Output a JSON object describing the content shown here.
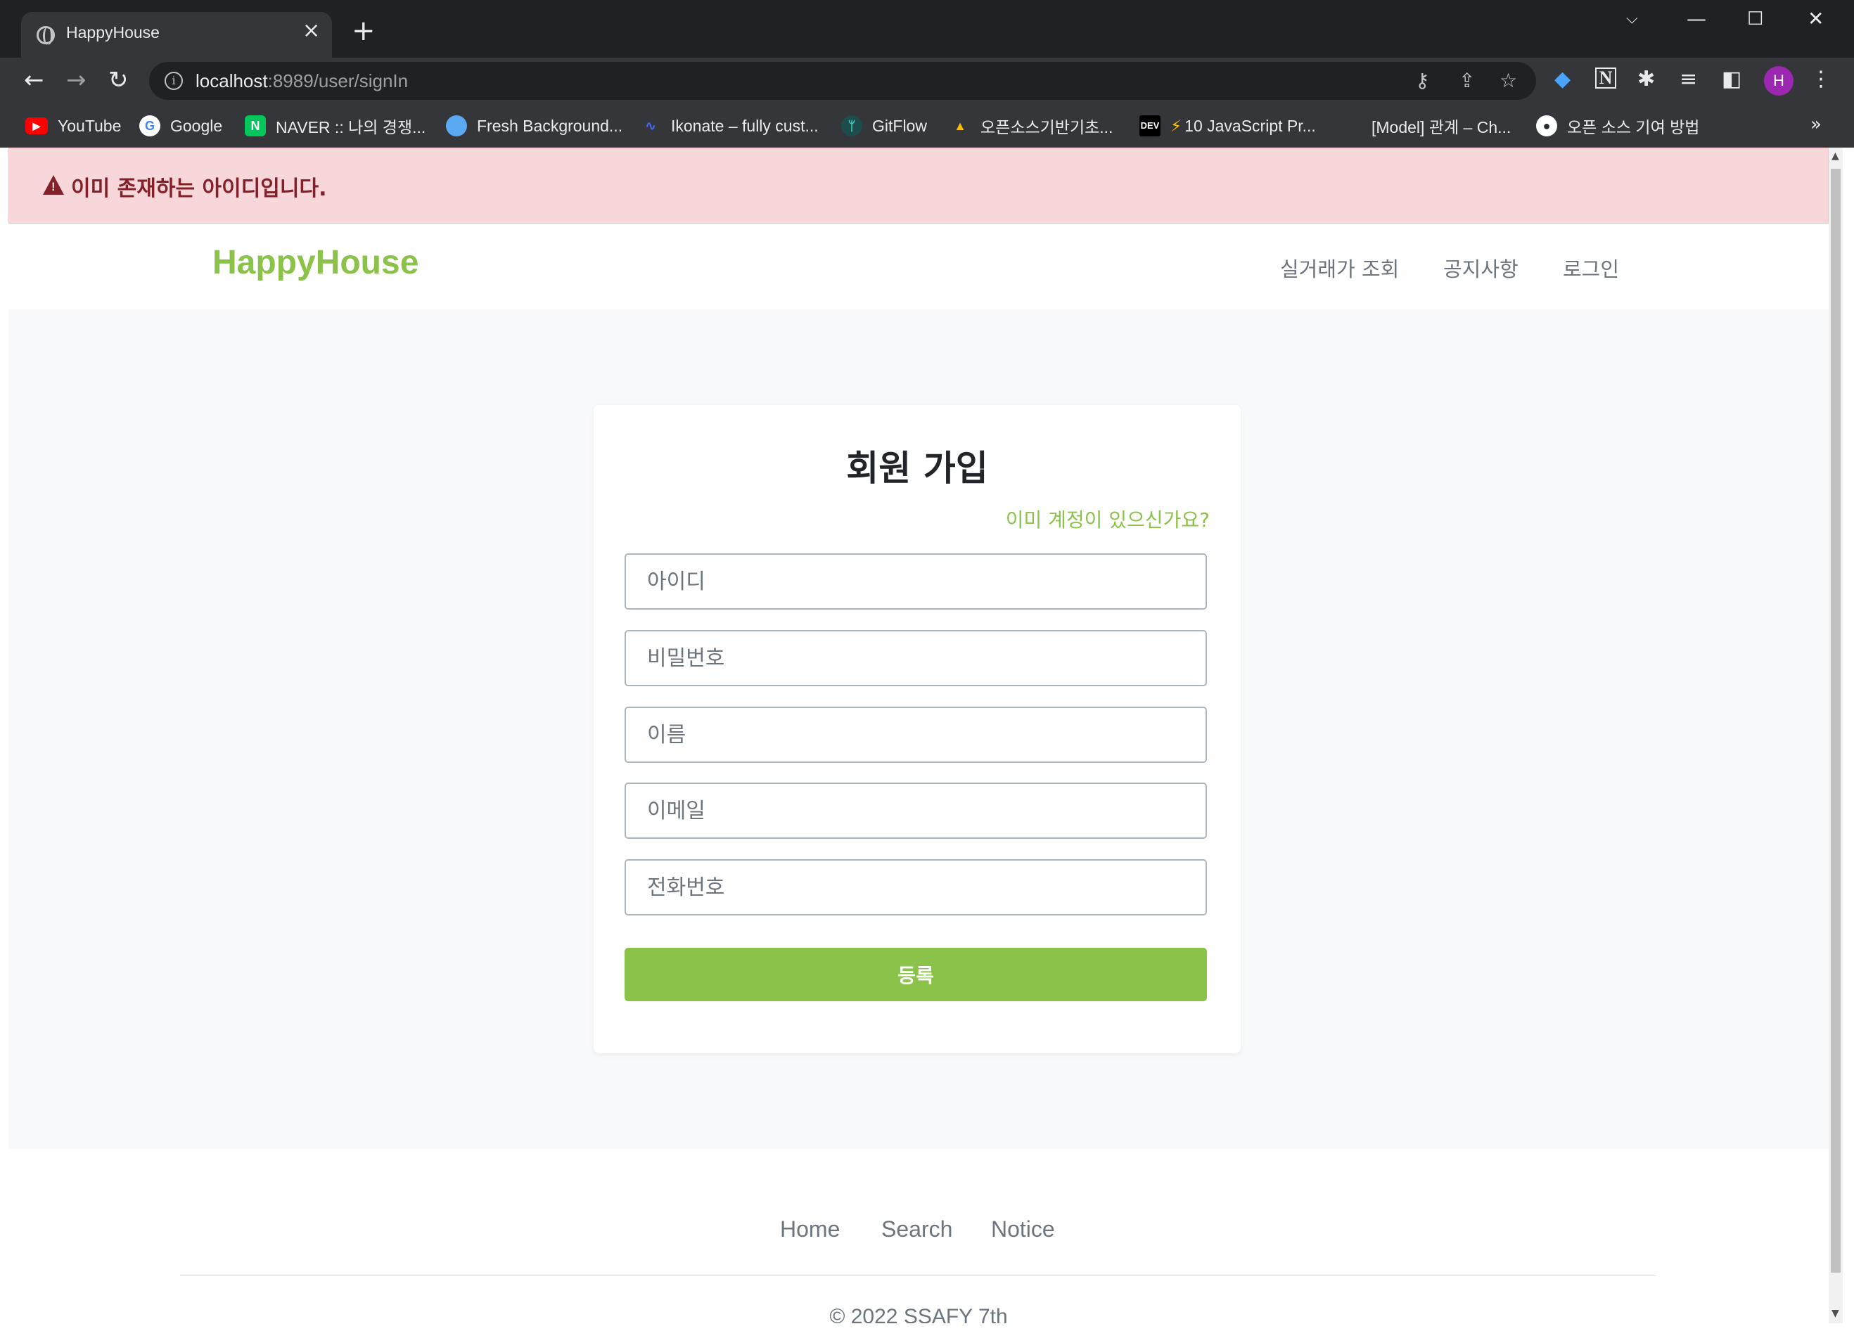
{
  "browser": {
    "tab_title": "HappyHouse",
    "url_host": "localhost",
    "url_path": ":8989/user/signIn",
    "bookmarks": [
      {
        "label": "YouTube",
        "icon": "youtube-icon"
      },
      {
        "label": "Google",
        "icon": "google-icon"
      },
      {
        "label": "NAVER :: 나의 경쟁...",
        "icon": "naver-icon"
      },
      {
        "label": "Fresh Background...",
        "icon": "fresh-background-icon"
      },
      {
        "label": "Ikonate – fully cust...",
        "icon": "ikonate-icon"
      },
      {
        "label": "GitFlow",
        "icon": "gitflow-icon"
      },
      {
        "label": "오픈소스기반기초...",
        "icon": "google-drive-icon"
      },
      {
        "label": "10 JavaScript Pr...",
        "icon": "dev-icon"
      },
      {
        "label": "[Model] 관계 – Ch...",
        "icon": "page-icon"
      },
      {
        "label": "오픈 소스 기여 방법",
        "icon": "github-icon"
      }
    ],
    "more_bookmarks": "»",
    "avatar_initial": "H"
  },
  "alert": {
    "message": "이미 존재하는 아이디입니다.",
    "color": "#842029",
    "background": "#f8d7da"
  },
  "navbar": {
    "brand": "HappyHouse",
    "links": [
      "실거래가 조회",
      "공지사항",
      "로그인"
    ]
  },
  "form": {
    "title": "회원 가입",
    "login_link": "이미 계정이 있으신가요?",
    "placeholders": {
      "id": "아이디",
      "password": "비밀번호",
      "name": "이름",
      "email": "이메일",
      "phone": "전화번호"
    },
    "submit_label": "등록",
    "accent_color": "#8bc34a"
  },
  "footer": {
    "links": [
      "Home",
      "Search",
      "Notice"
    ],
    "copyright": "© 2022 SSAFY 7th"
  }
}
